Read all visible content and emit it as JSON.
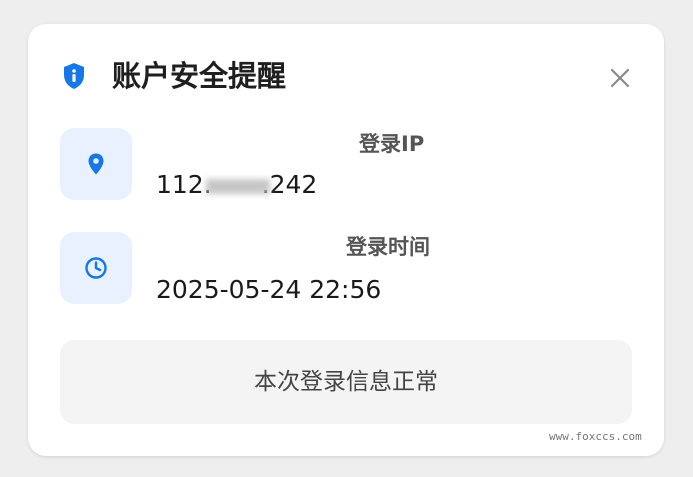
{
  "dialog": {
    "title": "账户安全提醒",
    "icon": "shield-info-icon",
    "close_icon": "close-icon"
  },
  "rows": [
    {
      "icon": "location-pin-icon",
      "label": "登录IP",
      "value_prefix": "112.",
      "value_suffix": ".242"
    },
    {
      "icon": "clock-icon",
      "label": "登录时间",
      "value": "2025-05-24 22:56"
    }
  ],
  "status": {
    "text": "本次登录信息正常"
  },
  "watermark": "www.foxccs.com",
  "colors": {
    "accent": "#1677e8",
    "icon_bg": "#e8f1fd",
    "status_bg": "#f4f4f4"
  }
}
